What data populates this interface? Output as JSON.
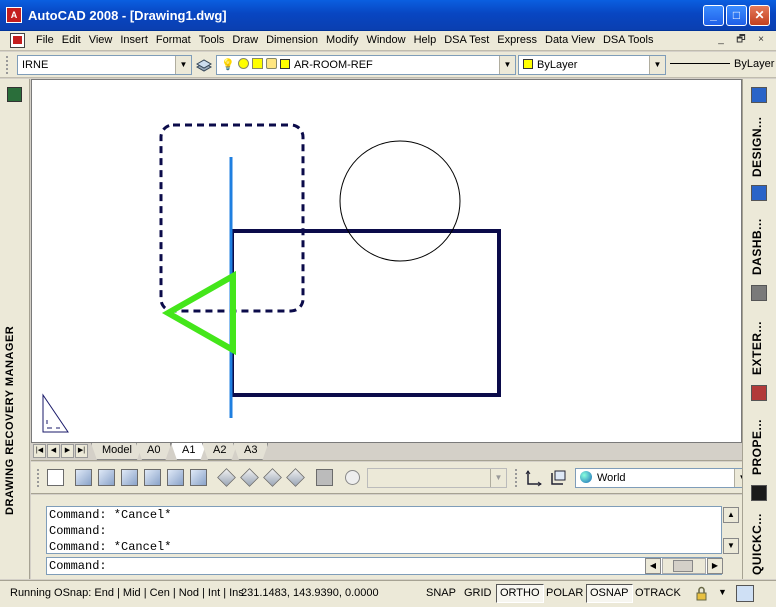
{
  "window": {
    "title": "AutoCAD 2008 - [Drawing1.dwg]",
    "app_icon": "autocad-logo-icon",
    "controls": {
      "minimize": "_",
      "maximize": "□",
      "close": "✕"
    }
  },
  "menu": {
    "items": [
      "File",
      "Edit",
      "View",
      "Insert",
      "Format",
      "Tools",
      "Draw",
      "Dimension",
      "Modify",
      "Window",
      "Help",
      "DSA Test",
      "Express",
      "Data View",
      "DSA Tools"
    ],
    "doc_controls": {
      "minimize": "_",
      "restore": "🗗",
      "close": "×"
    }
  },
  "layer_toolbar": {
    "style_combo": "IRNE",
    "layer_combo": "AR-ROOM-REF",
    "color_combo": "ByLayer",
    "linetype_label": "ByLayer",
    "colors": {
      "layer_swatch": "#ffff00",
      "color_swatch": "#ffff00"
    }
  },
  "left_panel": {
    "title": "DRAWING RECOVERY MANAGER"
  },
  "layout_tabs": {
    "tabs": [
      "Model",
      "A0",
      "A1",
      "A2",
      "A3"
    ],
    "active": "A1"
  },
  "view_toolbar": {
    "ucs_combo": "World"
  },
  "right_palettes": {
    "tabs": [
      {
        "label": "DESIGN...",
        "icon": "design-center-icon"
      },
      {
        "label": "DASHB...",
        "icon": "dashboard-icon"
      },
      {
        "label": "EXTER...",
        "icon": "external-references-icon"
      },
      {
        "label": "PROPE...",
        "icon": "properties-icon"
      },
      {
        "label": "QUICKC...",
        "icon": "quickcalc-icon"
      }
    ]
  },
  "command": {
    "history": [
      "Command: *Cancel*",
      "Command:",
      "Command: *Cancel*"
    ],
    "prompt": "Command:"
  },
  "status": {
    "osnap_text": "Running OSnap: End | Mid | Cen | Nod | Int | Ins",
    "coordinates": "231.1483, 143.9390, 0.0000",
    "toggles": [
      {
        "label": "SNAP",
        "on": false
      },
      {
        "label": "GRID",
        "on": false
      },
      {
        "label": "ORTHO",
        "on": true
      },
      {
        "label": "POLAR",
        "on": false
      },
      {
        "label": "OSNAP",
        "on": true
      },
      {
        "label": "OTRACK",
        "on": false
      }
    ]
  },
  "drawing_colors": {
    "rectangle": "#0b0b4a",
    "dashed_box": "#0b0b4a",
    "vertical_line": "#1f7fe0",
    "triangle": "#44e61a",
    "circle": "#000000"
  }
}
